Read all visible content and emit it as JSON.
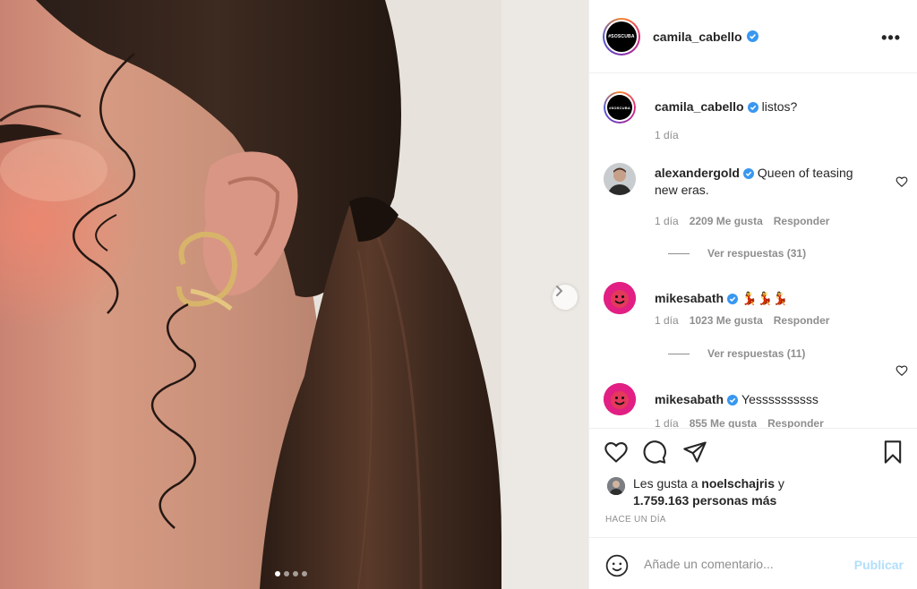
{
  "post": {
    "username": "camila_cabello",
    "avatar_text": "#SOSCUBA",
    "more_label": "•••"
  },
  "caption": {
    "username": "camila_cabello",
    "text": "listos?",
    "time": "1 día"
  },
  "comments": [
    {
      "username": "alexandergold",
      "text": "Queen of teasing new eras.",
      "time": "1 día",
      "likes": "2209 Me gusta",
      "reply": "Responder",
      "view_replies": "Ver respuestas (31)"
    },
    {
      "username": "mikesabath",
      "text": "💃💃💃",
      "time": "1 día",
      "likes": "1023 Me gusta",
      "reply": "Responder",
      "view_replies": "Ver respuestas (11)"
    },
    {
      "username": "mikesabath",
      "text": "Yessssssssss",
      "time": "1 día",
      "likes": "855 Me gusta",
      "reply": "Responder"
    }
  ],
  "likes_summary": {
    "prefix": "Les gusta a",
    "user": "noelschajris",
    "conjunction": "y",
    "count": "1.759.163 personas más"
  },
  "timestamp": "HACE UN DÍA",
  "add_comment": {
    "placeholder": "Añade un comentario...",
    "publish": "Publicar"
  },
  "carousel": {
    "total": 4,
    "current": 1
  },
  "colors": {
    "verified": "#3897f0",
    "publish_disabled": "#b2dffc",
    "muted": "#8e8e8e"
  }
}
